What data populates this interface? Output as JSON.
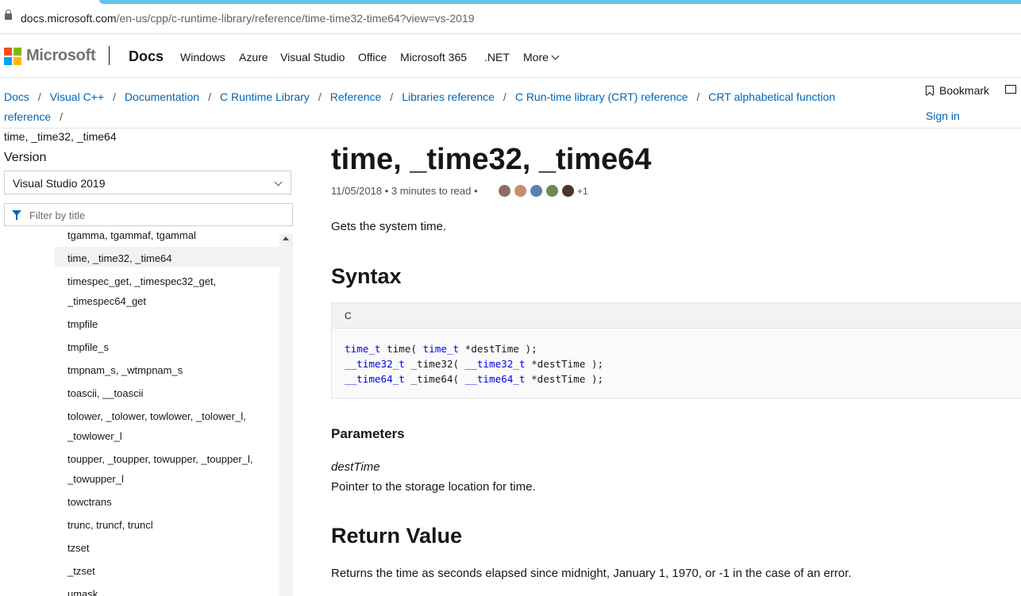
{
  "browser": {
    "url_domain": "docs.microsoft.com",
    "url_path": "/en-us/cpp/c-runtime-library/reference/time-time32-time64?view=vs-2019"
  },
  "header": {
    "brand": "Microsoft",
    "site": "Docs",
    "nav": [
      "Windows",
      "Azure",
      "Visual Studio",
      "Office",
      "Microsoft 365",
      ".NET",
      "More"
    ],
    "logo_colors": [
      "#f25022",
      "#7fba00",
      "#00a4ef",
      "#ffb900"
    ]
  },
  "breadcrumb": {
    "items": [
      "Docs",
      "Visual C++",
      "Documentation",
      "C Runtime Library",
      "Reference",
      "Libraries reference",
      "C Run-time library (CRT) reference",
      "CRT alphabetical function reference"
    ],
    "current": "time, _time32, _time64",
    "separator": "/"
  },
  "actions": {
    "bookmark": "Bookmark",
    "sign_in": "Sign in"
  },
  "sidebar": {
    "version_label": "Version",
    "version_selected": "Visual Studio 2019",
    "filter_placeholder": "Filter by title",
    "items": [
      {
        "label": "tgamma, tgammaf, tgammal",
        "lines": [
          "tgamma, tgammaf, tgammal"
        ]
      },
      {
        "label": "time, _time32, _time64",
        "lines": [
          "time, _time32, _time64"
        ],
        "active": true
      },
      {
        "label": "timespec_get, _timespec32_get, _timespec64_get",
        "lines": [
          "timespec_get, _timespec32_get,",
          "_timespec64_get"
        ]
      },
      {
        "label": "tmpfile",
        "lines": [
          "tmpfile"
        ]
      },
      {
        "label": "tmpfile_s",
        "lines": [
          "tmpfile_s"
        ]
      },
      {
        "label": "tmpnam_s, _wtmpnam_s",
        "lines": [
          "tmpnam_s, _wtmpnam_s"
        ]
      },
      {
        "label": "toascii, __toascii",
        "lines": [
          "toascii, __toascii"
        ]
      },
      {
        "label": "tolower, _tolower, towlower, _tolower_l, _towlower_l",
        "lines": [
          "tolower, _tolower, towlower, _tolower_l,",
          "_towlower_l"
        ]
      },
      {
        "label": "toupper, _toupper, towupper, _toupper_l, _towupper_l",
        "lines": [
          "toupper, _toupper, towupper, _toupper_l,",
          "_towupper_l"
        ]
      },
      {
        "label": "towctrans",
        "lines": [
          "towctrans"
        ]
      },
      {
        "label": "trunc, truncf, truncl",
        "lines": [
          "trunc, truncf, truncl"
        ]
      },
      {
        "label": "tzset",
        "lines": [
          "tzset"
        ]
      },
      {
        "label": "_tzset",
        "lines": [
          "_tzset"
        ]
      },
      {
        "label": "umask",
        "lines": [
          "umask"
        ]
      }
    ]
  },
  "article": {
    "title": "time, _time32, _time64",
    "date": "11/05/2018",
    "read_time": "3 minutes to read",
    "contributors_extra": "+1",
    "contributor_colors": [
      "#8d6e63",
      "#c98b6a",
      "#5b7fb5",
      "#6d8b5a",
      "#4e342e"
    ],
    "summary": "Gets the system time.",
    "syntax_heading": "Syntax",
    "code_lang": "C",
    "code_lines": [
      [
        {
          "t": "time_t",
          "type": true
        },
        {
          "t": " time( "
        },
        {
          "t": "time_t",
          "type": true
        },
        {
          "t": " *destTime );"
        }
      ],
      [
        {
          "t": "__time32_t",
          "type": true
        },
        {
          "t": " _time32( "
        },
        {
          "t": "__time32_t",
          "type": true
        },
        {
          "t": " *destTime );"
        }
      ],
      [
        {
          "t": "__time64_t",
          "type": true
        },
        {
          "t": " _time64( "
        },
        {
          "t": "__time64_t",
          "type": true
        },
        {
          "t": " *destTime );"
        }
      ]
    ],
    "parameters_heading": "Parameters",
    "param_name": "destTime",
    "param_desc": "Pointer to the storage location for time.",
    "return_heading": "Return Value",
    "return_desc": "Returns the time as seconds elapsed since midnight, January 1, 1970, or -1 in the case of an error."
  }
}
